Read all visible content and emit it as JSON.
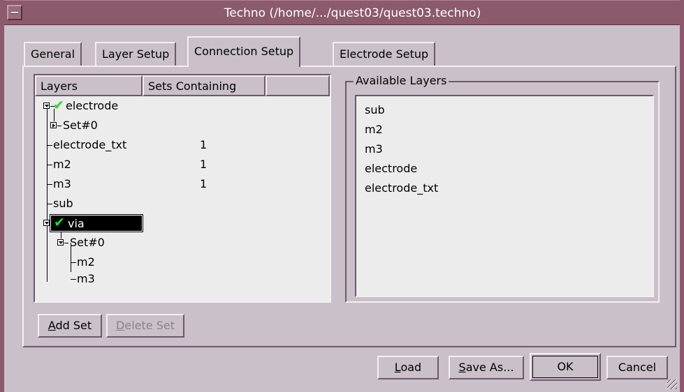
{
  "window": {
    "title": "Techno (/home/.../quest03/quest03.techno)"
  },
  "tabs": [
    {
      "label": "General",
      "active": false
    },
    {
      "label": "Layer Setup",
      "active": false
    },
    {
      "label": "Connection Setup",
      "active": true
    },
    {
      "label": "Electrode Setup",
      "active": false
    }
  ],
  "tree": {
    "columns": [
      "Layers",
      "Sets Containing",
      ""
    ],
    "rows": [
      {
        "label": "electrode",
        "count": "",
        "checked": true
      },
      {
        "label": "Set#0",
        "count": ""
      },
      {
        "label": "electrode_txt",
        "count": "1"
      },
      {
        "label": "m2",
        "count": "1"
      },
      {
        "label": "m3",
        "count": "1"
      },
      {
        "label": "sub",
        "count": ""
      },
      {
        "label": "via",
        "count": "",
        "checked": true,
        "selected": true
      },
      {
        "label": "Set#0",
        "count": ""
      },
      {
        "label": "m2",
        "count": ""
      },
      {
        "label": "m3",
        "count": ""
      }
    ]
  },
  "available_layers": {
    "title": "Available Layers",
    "items": [
      "sub",
      "m2",
      "m3",
      "electrode",
      "electrode_txt"
    ]
  },
  "set_buttons": {
    "add_set": {
      "mnemonic": "A",
      "rest": "dd Set"
    },
    "delete_set": {
      "mnemonic": "D",
      "rest": "elete Set",
      "enabled": false
    }
  },
  "dialog_buttons": {
    "load": {
      "mnemonic": "L",
      "rest": "oad"
    },
    "save_as": {
      "mnemonic": "S",
      "rest": "ave As..."
    },
    "ok": "OK",
    "cancel": "Cancel"
  },
  "icons": {
    "window_menu": "window-menu-icon",
    "check": "checkmark-icon",
    "expand": "expand-toggle-icon"
  },
  "colors": {
    "titlebar": "#8b5a6c",
    "dialog_bg": "#c9c0ca",
    "list_bg": "#ececec",
    "check": "#22dd22"
  }
}
